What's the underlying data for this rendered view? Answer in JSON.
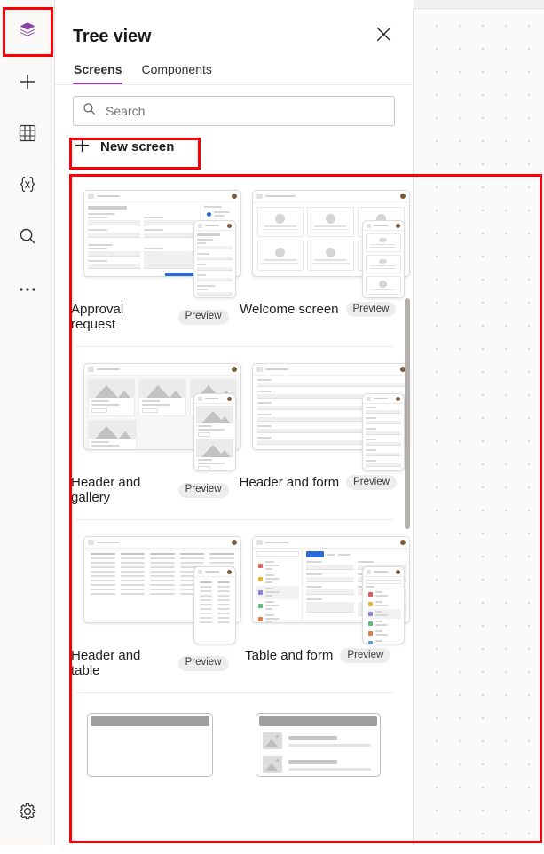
{
  "app": {
    "panel_title": "Tree view",
    "close_icon": "close-icon"
  },
  "rail": {
    "items": [
      {
        "name": "tree-view",
        "icon": "layers-icon",
        "active": true
      },
      {
        "name": "insert",
        "icon": "plus-icon",
        "active": false
      },
      {
        "name": "data",
        "icon": "table-icon",
        "active": false
      },
      {
        "name": "variables",
        "icon": "variables-icon",
        "active": false
      },
      {
        "name": "search",
        "icon": "search-icon",
        "active": false
      },
      {
        "name": "more",
        "icon": "ellipsis-icon",
        "active": false
      }
    ],
    "bottom": {
      "name": "settings",
      "icon": "gear-icon"
    }
  },
  "tabs": [
    {
      "label": "Screens",
      "active": true
    },
    {
      "label": "Components",
      "active": false
    }
  ],
  "search": {
    "placeholder": "Search",
    "value": "",
    "icon": "search-icon"
  },
  "new_screen": {
    "label": "New screen",
    "icon": "plus-icon"
  },
  "templates": {
    "preview_badge": "Preview",
    "items": [
      {
        "label": "Approval request",
        "badge": "Preview",
        "art": "approval"
      },
      {
        "label": "Welcome screen",
        "badge": "Preview",
        "art": "welcome"
      },
      {
        "label": "Header and gallery",
        "badge": "Preview",
        "art": "gallery"
      },
      {
        "label": "Header and form",
        "badge": "Preview",
        "art": "form"
      },
      {
        "label": "Header and table",
        "badge": "Preview",
        "art": "table"
      },
      {
        "label": "Table and form",
        "badge": "Preview",
        "art": "tableform"
      }
    ]
  },
  "colors": {
    "accent": "#8a3ea8",
    "annotation": "#fb0007",
    "tab_underline": "#8a3ea8",
    "scrollbar": "#b3b0ad",
    "blue_button": "#2b6cd4"
  }
}
